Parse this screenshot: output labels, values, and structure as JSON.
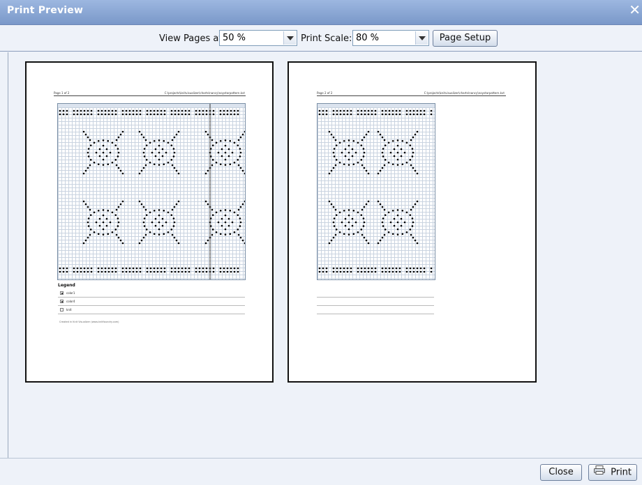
{
  "window": {
    "title": "Print Preview",
    "close_glyph": "✕"
  },
  "toolbar": {
    "view_pages_label": "View Pages at",
    "view_pages_value": "50 %",
    "print_scale_label": "Print Scale:",
    "print_scale_value": "80 %",
    "page_setup_label": "Page Setup"
  },
  "pages": [
    {
      "header_left": "Page 1 of 2",
      "header_right": "C:\\projects\\knitvisualizer\\charts\\nancy\\noystarpattern.kvt"
    },
    {
      "header_left": "Page 2 of 2",
      "header_right": "C:\\projects\\knitvisualizer\\charts\\nancy\\noystarpattern.kvt"
    }
  ],
  "legend": {
    "title": "Legend",
    "items": [
      "color1",
      "color4",
      "knit"
    ]
  },
  "footer_note": "Created in Knit Visualizer (www.knitfoundry.com)",
  "bottom": {
    "close_label": "Close",
    "print_label": "Print"
  }
}
